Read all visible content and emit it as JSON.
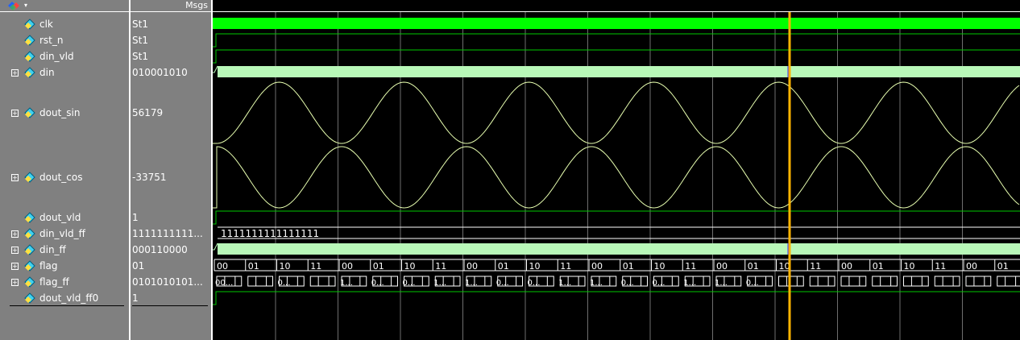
{
  "header": {
    "msgs_label": "Msgs"
  },
  "colors": {
    "clk": "#00ff00",
    "trace": "#00c800",
    "bus_fill": "#b8f8b8",
    "analog": "#e8ffb0",
    "cursor": "#ffb400",
    "grid": "#6e6e6e"
  },
  "icons": {
    "header": "waveform-window-icon",
    "signal": "signal-diamond-icon"
  },
  "signals": [
    {
      "name": "clk",
      "value": "St1",
      "expandable": false,
      "type": "clock"
    },
    {
      "name": "rst_n",
      "value": "St1",
      "expandable": false,
      "type": "bit"
    },
    {
      "name": "din_vld",
      "value": "St1",
      "expandable": false,
      "type": "bit"
    },
    {
      "name": "din",
      "value": "010001010",
      "expandable": true,
      "type": "bus"
    },
    {
      "name": "dout_sin",
      "value": "56179",
      "expandable": true,
      "type": "analog_sin"
    },
    {
      "name": "dout_cos",
      "value": "-33751",
      "expandable": true,
      "type": "analog_cos"
    },
    {
      "name": "dout_vld",
      "value": "1",
      "expandable": false,
      "type": "bit"
    },
    {
      "name": "din_vld_ff",
      "value": "1111111111...",
      "expandable": true,
      "type": "bus_label",
      "wave_label": "1111111111111111"
    },
    {
      "name": "din_ff",
      "value": "000110000",
      "expandable": true,
      "type": "bus"
    },
    {
      "name": "flag",
      "value": "01",
      "expandable": true,
      "type": "flag"
    },
    {
      "name": "flag_ff",
      "value": "0101010101...",
      "expandable": true,
      "type": "flag_ff"
    },
    {
      "name": "dout_vld_ff0",
      "value": "1",
      "expandable": false,
      "type": "bit"
    }
  ],
  "flag_cycle": [
    "00",
    "01",
    "10",
    "11"
  ],
  "flag_ff_labels": [
    "00...",
    "0...",
    "0...",
    "1...",
    "1...",
    "0...",
    "0...",
    "1...",
    "1...",
    "0...",
    "0...",
    "1...",
    "1...",
    "0...",
    "0...",
    "1...",
    "1...",
    "0..."
  ]
}
